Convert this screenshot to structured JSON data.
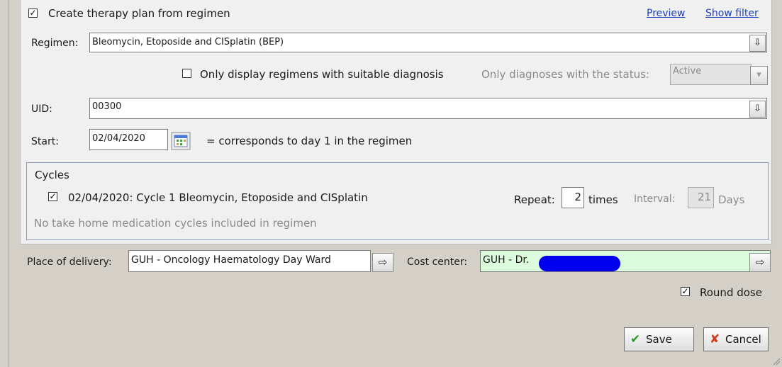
{
  "header": {
    "create_plan_checked": "☑",
    "create_plan_label": "Create therapy plan from regimen",
    "preview_link": "Preview",
    "show_filter_link": "Show filter"
  },
  "regimen": {
    "label": "Regimen:",
    "value": "Bleomycin, Etoposide and CISplatin (BEP)",
    "button_glyph": "⇩"
  },
  "filter": {
    "suitable_diagnosis_label": "Only display regimens with suitable diagnosis",
    "diagnosis_status_label": "Only diagnoses with the status:",
    "diagnosis_status_value": "Active",
    "dropdown_glyph": "▾"
  },
  "uid": {
    "label": "UID:",
    "value": "00300",
    "button_glyph": "⇩"
  },
  "start": {
    "label": "Start:",
    "value": "02/04/2020",
    "note": "= corresponds to day 1 in the regimen"
  },
  "cycles": {
    "title": "Cycles",
    "items": [
      {
        "label": "02/04/2020: Cycle 1 Bleomycin, Etoposide and CISplatin"
      }
    ],
    "repeat_label": "Repeat:",
    "repeat_value": "2",
    "times_label": "times",
    "interval_label": "Interval:",
    "interval_value": "21",
    "days_label": "Days",
    "no_home_med_text": "No take home medication cycles included in regimen"
  },
  "delivery": {
    "place_label": "Place of delivery:",
    "place_value": "GUH - Oncology Haematology Day Ward",
    "cost_center_label": "Cost center:",
    "cost_center_value": "GUH - Dr.",
    "button_glyph": "⇨"
  },
  "options": {
    "round_dose_label": "Round dose"
  },
  "actions": {
    "save_label": "Save",
    "cancel_label": "Cancel"
  },
  "colors": {
    "panel": "#f0f0f0",
    "background": "#d4d0c8",
    "link": "#1a3fc0",
    "cost_center_bg": "#dcfadc",
    "redaction": "#0000ee",
    "save_icon": "#2e9b2e",
    "cancel_icon": "#d23a1e"
  }
}
